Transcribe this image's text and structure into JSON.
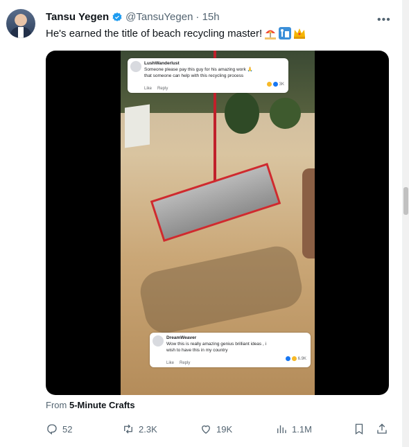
{
  "author": {
    "name": "Tansu Yegen",
    "handle": "@TansuYegen",
    "time": "· 15h"
  },
  "tweet": {
    "text": "He's earned the title of beach recycling master!",
    "emojis": [
      "beach-umbrella-emoji",
      "recycling-bin-emoji",
      "crown-emoji"
    ]
  },
  "video": {
    "comment_top": {
      "name": "LushWanderlust",
      "text_line1": "Someone please pay this guy for his amazing work 🙏",
      "text_line2": "that someone can help with this recycling process",
      "like": "Like",
      "reply": "Reply",
      "reactions": "3K"
    },
    "comment_bottom": {
      "name": "DreamWeaver",
      "text_line1": "Wow this is really amazing genius brilliant ideas , i",
      "text_line2": "wish to have this in my country",
      "like": "Like",
      "reply": "Reply",
      "reactions": "6.9K"
    }
  },
  "source": {
    "prefix": "From",
    "name": "5-Minute Crafts"
  },
  "actions": {
    "replies": "52",
    "retweets": "2.3K",
    "likes": "19K",
    "views": "1.1M"
  },
  "colors": {
    "verified": "#1d9bf0",
    "muted": "#536471",
    "pole": "#c0202b"
  }
}
